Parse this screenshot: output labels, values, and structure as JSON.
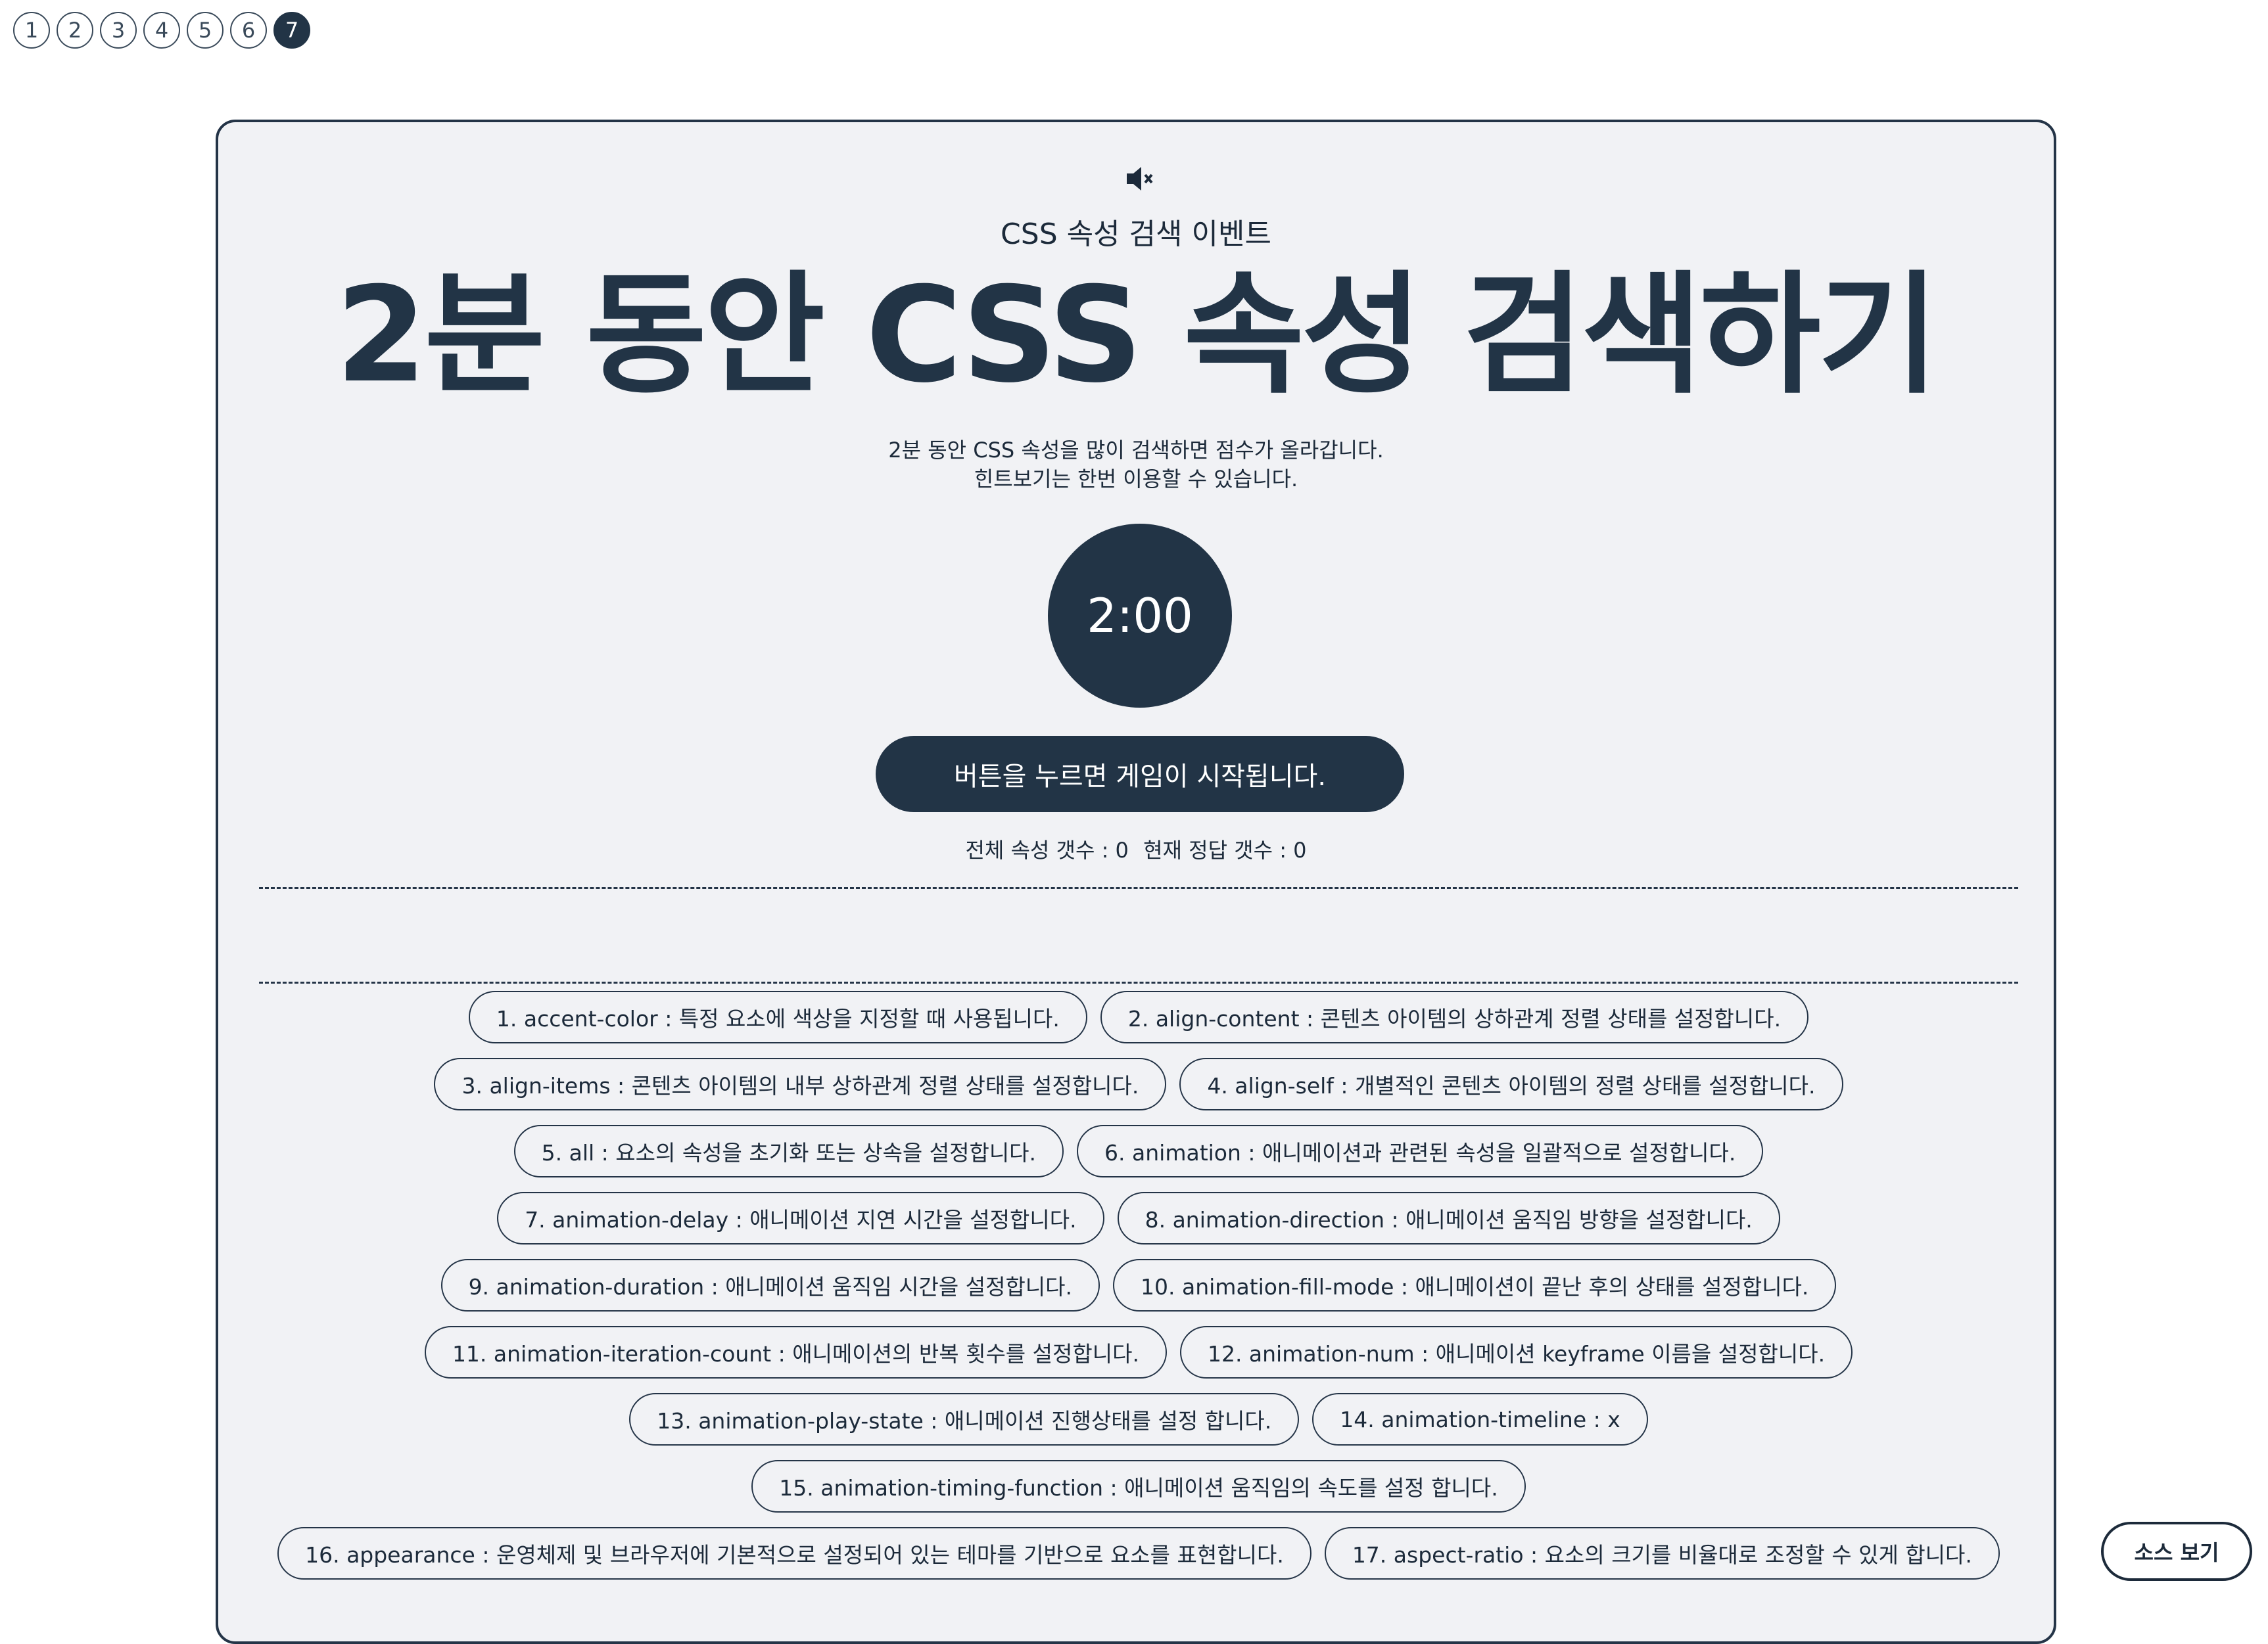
{
  "pager": {
    "pages": [
      "1",
      "2",
      "3",
      "4",
      "5",
      "6",
      "7"
    ],
    "active_index": 6
  },
  "header": {
    "mute_icon": "speaker-muted-icon",
    "eyebrow": "CSS 속성 검색 이벤트",
    "title": "2분 동안 CSS 속성 검색하기",
    "desc_line1": "2분 동안 CSS 속성을 많이 검색하면 점수가 올라갑니다.",
    "desc_line2": "힌트보기는 한번 이용할 수 있습니다."
  },
  "timer": {
    "value": "2:00"
  },
  "start_button": {
    "label": "버튼을 누르면 게임이 시작됩니다."
  },
  "stats": {
    "total_label": "전체 속성 갯수 : 0",
    "correct_label": "현재 정답 갯수 : 0"
  },
  "properties": [
    "1. accent-color : 특정 요소에 색상을 지정할 때 사용됩니다.",
    "2. align-content : 콘텐츠 아이템의 상하관계 정렬 상태를 설정합니다.",
    "3. align-items : 콘텐츠 아이템의 내부 상하관계 정렬 상태를 설정합니다.",
    "4. align-self : 개별적인 콘텐츠 아이템의 정렬 상태를 설정합니다.",
    "5. all : 요소의 속성을 초기화 또는 상속을 설정합니다.",
    "6. animation : 애니메이션과 관련된 속성을 일괄적으로 설정합니다.",
    "7. animation-delay : 애니메이션 지연 시간을 설정합니다.",
    "8. animation-direction : 애니메이션 움직임 방향을 설정합니다.",
    "9. animation-duration : 애니메이션 움직임 시간을 설정합니다.",
    "10. animation-fill-mode : 애니메이션이 끝난 후의 상태를 설정합니다.",
    "11. animation-iteration-count : 애니메이션의 반복 횟수를 설정합니다.",
    "12. animation-num : 애니메이션 keyframe 이름을 설정합니다.",
    "13. animation-play-state : 애니메이션 진행상태를 설정 합니다.",
    "14. animation-timeline : x",
    "15. animation-timing-function : 애니메이션 움직임의 속도를 설정 합니다.",
    "16. appearance : 운영체제 및 브라우저에 기본적으로 설정되어 있는 테마를 기반으로 요소를 표현합니다.",
    "17. aspect-ratio : 요소의 크기를 비율대로 조정할 수 있게 합니다."
  ],
  "source_button": {
    "label": "소스 보기"
  }
}
